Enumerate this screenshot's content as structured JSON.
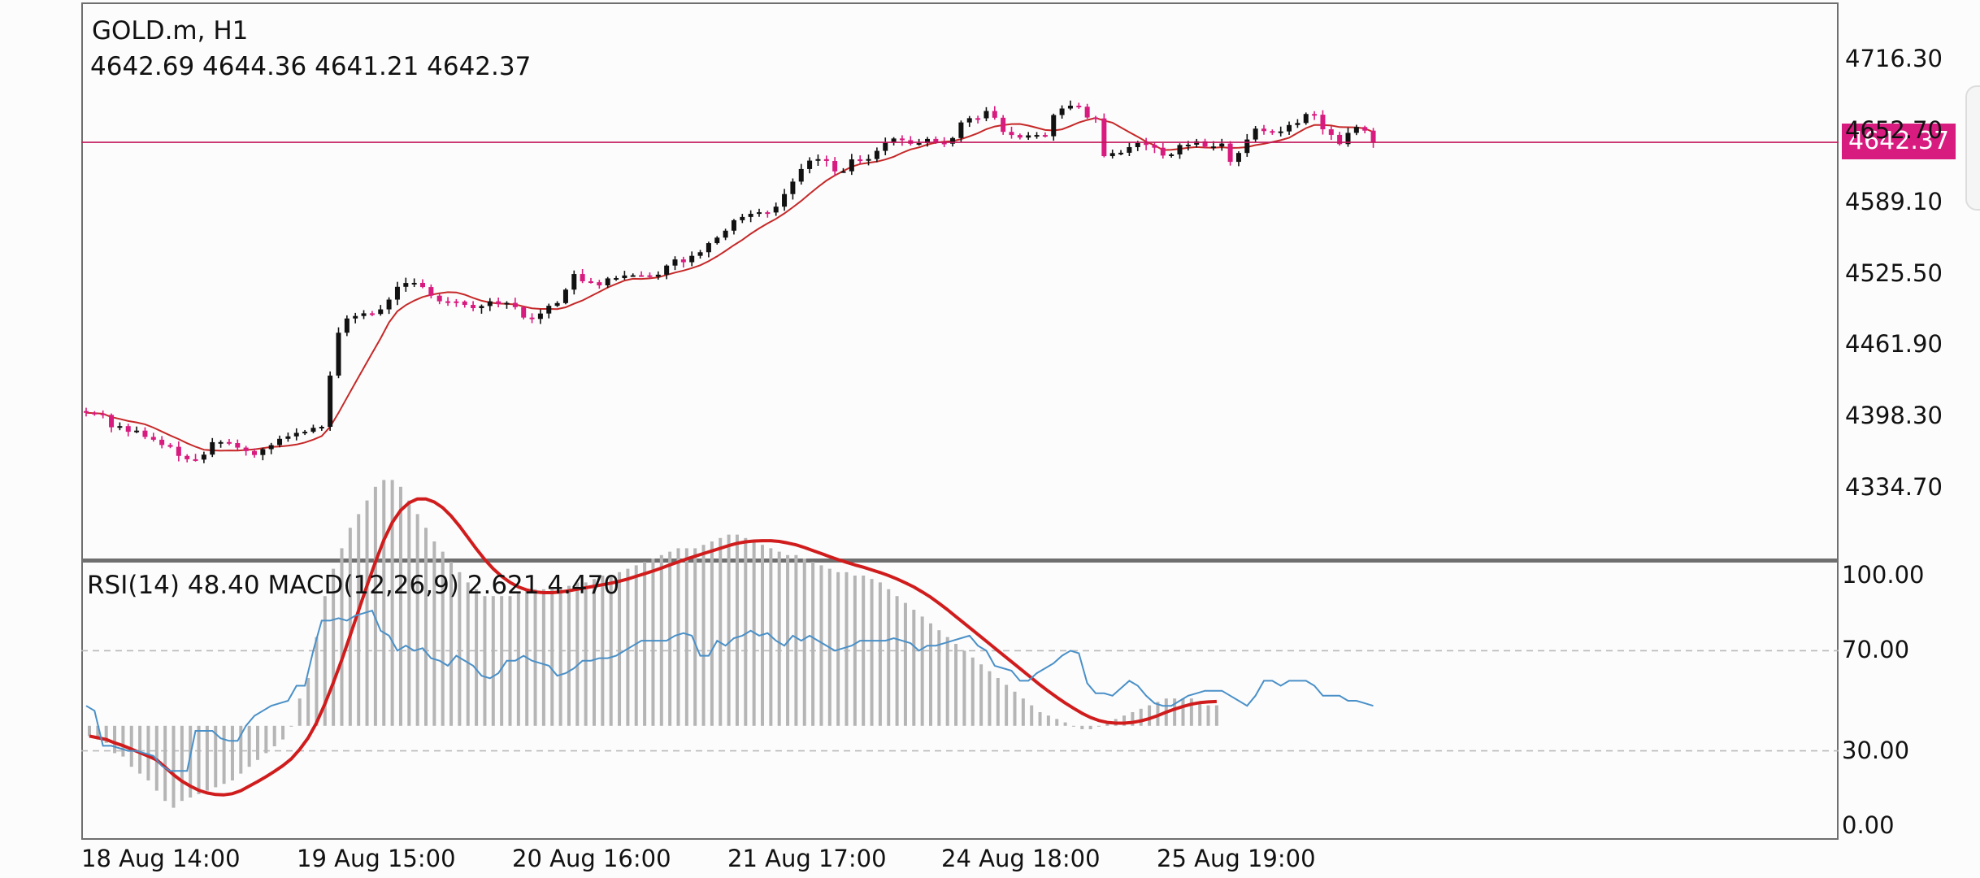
{
  "header": {
    "symbol_timeframe": "GOLD.m, H1",
    "ohlc": "4642.69 4644.36 4641.21 4642.37"
  },
  "current_price": "4642.37",
  "indicator_header": "RSI(14) 48.40 MACD(12,26,9) 2.621 4.470",
  "colors": {
    "bull_candle": "#111111",
    "bear_candle": "#d81b7f",
    "ma_line": "#c62828",
    "price_line": "#c2185b",
    "rsi_line": "#4a90c8",
    "macd_hist": "#b5b5b5",
    "macd_signal": "#d01c1c",
    "level_line": "#b9b9b9"
  },
  "chart_data": [
    {
      "type": "candlestick",
      "title": "GOLD.m, H1",
      "ylim": [
        4302.9,
        4748.1
      ],
      "y_ticks": [
        "4716.30",
        "4652.70",
        "4589.10",
        "4525.50",
        "4461.90",
        "4398.30",
        "4334.70"
      ],
      "x_ticks": [
        "18 Aug 14:00",
        "19 Aug 15:00",
        "20 Aug 16:00",
        "21 Aug 17:00",
        "24 Aug 18:00",
        "25 Aug 19:00"
      ],
      "last_price": 4642.37,
      "series": [
        {
          "type": "candles",
          "close": [
            4401.5,
            4400.8,
            4399.6,
            4388.6,
            4389.6,
            4384.6,
            4385.6,
            4380.0,
            4377.5,
            4372.8,
            4371.2,
            4363.1,
            4360.1,
            4359.8,
            4364.2,
            4375.3,
            4375.4,
            4374.5,
            4370.5,
            4367.4,
            4363.9,
            4369.1,
            4372.7,
            4378.3,
            4380.5,
            4383.6,
            4384.6,
            4388.1,
            4389.0,
            4434.6,
            4472.8,
            4485.5,
            4487.7,
            4490.1,
            4489.5,
            4493.6,
            4502.3,
            4513.7,
            4517.1,
            4517.2,
            4513.5,
            4505.8,
            4500.8,
            4500.7,
            4500.6,
            4497.6,
            4494.7,
            4496.6,
            4500.8,
            4498.3,
            4499.4,
            4495.6,
            4486.3,
            4485.1,
            4489.9,
            4496.8,
            4499.2,
            4511.2,
            4525.1,
            4518.6,
            4517.8,
            4515.0,
            4521.2,
            4521.5,
            4523.8,
            4524.0,
            4523.9,
            4522.7,
            4524.5,
            4532.6,
            4538.1,
            4535.6,
            4541.3,
            4544.5,
            4552.6,
            4557.5,
            4563.7,
            4573.0,
            4575.9,
            4578.7,
            4580.1,
            4579.9,
            4585.1,
            4596.3,
            4607.4,
            4618.6,
            4626.1,
            4627.4,
            4625.8,
            4616.5,
            4616.6,
            4627.2,
            4626.0,
            4627.5,
            4634.8,
            4642.1,
            4645.8,
            4644.3,
            4641.1,
            4641.7,
            4645.4,
            4642.1,
            4641.2,
            4646.2,
            4660.1,
            4663.9,
            4663.8,
            4670.3,
            4664.3,
            4651.7,
            4648.9,
            4646.6,
            4648.6,
            4648.9,
            4647.8,
            4666.7,
            4672.5,
            4675.0,
            4674.1,
            4664.5,
            4663.7,
            4630.1,
            4632.8,
            4633.1,
            4638.1,
            4641.8,
            4640.1,
            4637.6,
            4630.6,
            4631.6,
            4640.0,
            4640.3,
            4643.3,
            4638.6,
            4638.7,
            4641.3,
            4625.0,
            4632.9,
            4644.9,
            4654.6,
            4652.4,
            4651.6,
            4652.1,
            4657.8,
            4659.6,
            4667.6,
            4667.0,
            4654.0,
            4649.0,
            4640.8,
            4650.8,
            4656.0,
            4652.8,
            4642.4
          ]
        },
        {
          "type": "moving_average",
          "name": "",
          "color": "#c62828"
        }
      ]
    },
    {
      "type": "line",
      "title": "RSI(14) MACD(12,26,9)",
      "ylim": [
        0,
        100
      ],
      "y_ticks": [
        "100.00",
        "70.00",
        "30.00",
        "0.00"
      ],
      "levels": [
        70,
        30
      ],
      "series": [
        {
          "name": "RSI(14)",
          "last": 48.4,
          "values": [
            48,
            46,
            32,
            32,
            31,
            30,
            30,
            29,
            28,
            24,
            22,
            22,
            22,
            38,
            38,
            38,
            35,
            34,
            34,
            40,
            44,
            46,
            48,
            49,
            50,
            56,
            56,
            70,
            82,
            82,
            83,
            82,
            84,
            85,
            86,
            78,
            76,
            70,
            72,
            70,
            71,
            67,
            66,
            64,
            68,
            66,
            64,
            60,
            59,
            61,
            66,
            66,
            68,
            66,
            65,
            64,
            60,
            61,
            63,
            66,
            66,
            67,
            67,
            68,
            70,
            72,
            74,
            74,
            74,
            74,
            76,
            77,
            76,
            68,
            68,
            74,
            72,
            75,
            76,
            78,
            76,
            77,
            74,
            72,
            76,
            74,
            76,
            74,
            72,
            70,
            71,
            72,
            74,
            74,
            74,
            74,
            75,
            74,
            73,
            70,
            72,
            72,
            73,
            74,
            75,
            76,
            72,
            70,
            64,
            63,
            62,
            58,
            58,
            61,
            63,
            65,
            68,
            70,
            69,
            57,
            53,
            53,
            52,
            55,
            58,
            56,
            52,
            49,
            48,
            48,
            50,
            52,
            53,
            54,
            54,
            54,
            52,
            50,
            48,
            52,
            58,
            58,
            56,
            58,
            58,
            58,
            56,
            52,
            52,
            52,
            50,
            50,
            49,
            48
          ]
        },
        {
          "name": "MACD histogram",
          "values": [
            -3,
            -4,
            -5,
            -8,
            -9,
            -12,
            -14,
            -16,
            -19,
            -22,
            -24,
            -22,
            -21,
            -20,
            -19,
            -18,
            -17,
            -16,
            -14,
            -12,
            -10,
            -8,
            -6,
            -4,
            0,
            8,
            14,
            26,
            38,
            46,
            52,
            58,
            62,
            66,
            70,
            72,
            72,
            70,
            66,
            62,
            58,
            54,
            51,
            48,
            45,
            42,
            40,
            38,
            38,
            38,
            38,
            39,
            40,
            40,
            40,
            40,
            40,
            41,
            42,
            42,
            43,
            44,
            44,
            45,
            46,
            47,
            48,
            49,
            50,
            51,
            52,
            52,
            52,
            53,
            54,
            55,
            56,
            56,
            55,
            54,
            53,
            52,
            51,
            50,
            50,
            49,
            48,
            47,
            46,
            45,
            45,
            44,
            44,
            43,
            42,
            40,
            38,
            36,
            34,
            32,
            30,
            28,
            26,
            24,
            22,
            20,
            18,
            16,
            14,
            12,
            10,
            8,
            6,
            4,
            3,
            2,
            1,
            0,
            -1,
            -1,
            0,
            1,
            2,
            3,
            4,
            5,
            6,
            7,
            8,
            8,
            8,
            8,
            7,
            6,
            6
          ]
        },
        {
          "name": "MACD signal",
          "last": 4.47
        }
      ]
    }
  ]
}
